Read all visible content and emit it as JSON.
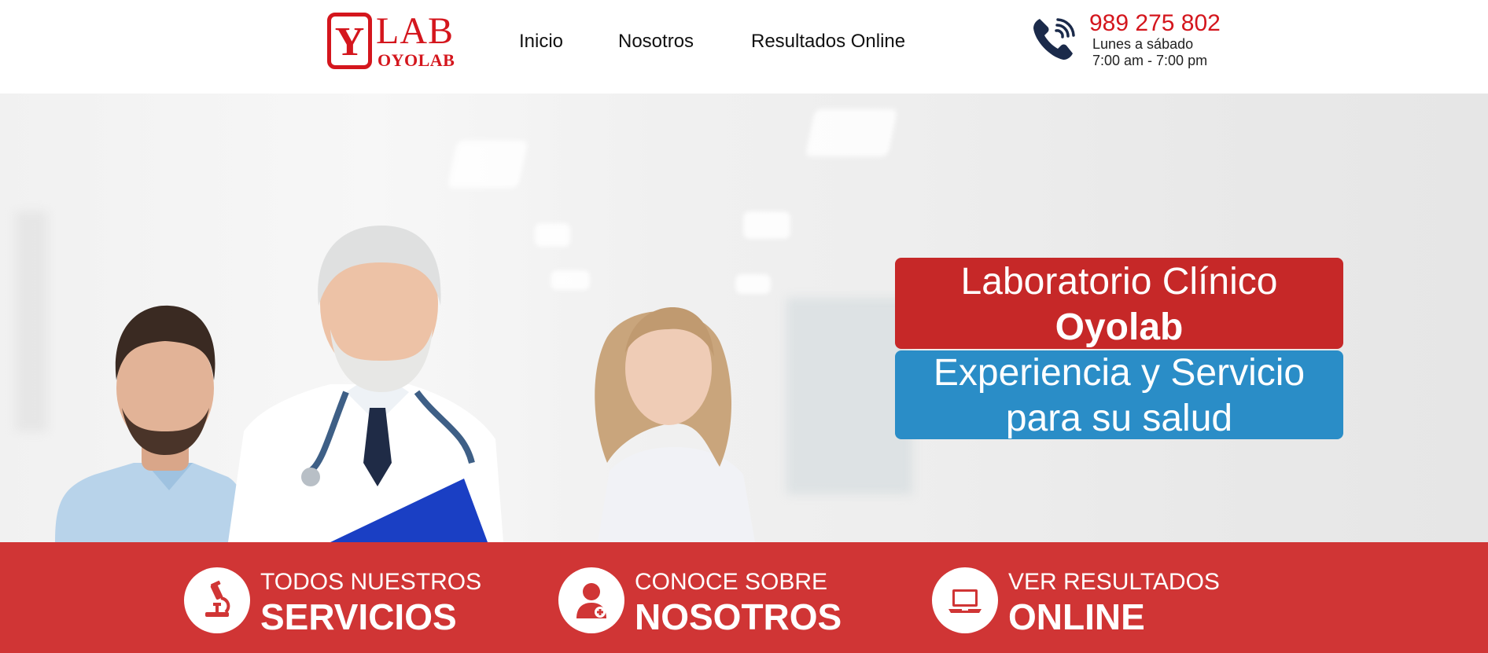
{
  "header": {
    "logo": {
      "mark": "Y",
      "lab": "LAB",
      "name": "OYOLAB"
    },
    "nav": [
      {
        "label": "Inicio"
      },
      {
        "label": "Nosotros"
      },
      {
        "label": "Resultados Online"
      }
    ],
    "contact": {
      "icon": "phone-icon",
      "phone": "989 275 802",
      "days": "Lunes a sábado",
      "hours": "7:00 am - 7:00 pm"
    }
  },
  "hero": {
    "title_line1": "Laboratorio Clínico",
    "title_line2": "Oyolab",
    "tagline_line1": "Experiencia y Servicio",
    "tagline_line2": "para su salud"
  },
  "features": [
    {
      "small": "TODOS NUESTROS",
      "big": "SERVICIOS",
      "icon": "microscope-icon"
    },
    {
      "small": "CONOCE SOBRE",
      "big": "NOSOTROS",
      "icon": "doctor-icon"
    },
    {
      "small": "VER RESULTADOS",
      "big": "ONLINE",
      "icon": "laptop-icon"
    }
  ],
  "colors": {
    "brand_red": "#d4161d",
    "title_red": "#c62828",
    "tagline_blue": "#2a8dc7",
    "feature_bar": "#d03535",
    "phone_icon": "#1b2a4a"
  }
}
